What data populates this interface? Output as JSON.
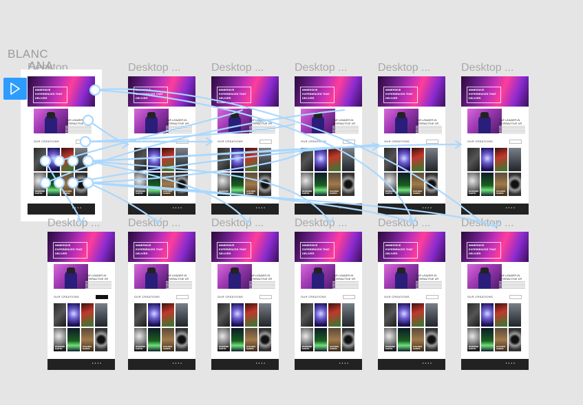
{
  "start": {
    "label_line1": "BLANC",
    "label_line2": "ANA",
    "play_icon": "play-icon"
  },
  "frames": [
    {
      "label": "Desktop ...",
      "hero": "IMMERSIVE EXPERIENCES THAT DELIVER",
      "leader": "THE LEADER IN INTERACTIVE VR",
      "creations": "OUR CREATIONS"
    },
    {
      "label": "Desktop ...",
      "hero": "IMMERSIVE EXPERIENCES THAT DELIVER",
      "leader": "THE LEADER IN INTERACTIVE VR",
      "creations": "OUR CREATIONS"
    },
    {
      "label": "Desktop ...",
      "hero": "IMMERSIVE EXPERIENCES THAT DELIVER",
      "leader": "THE LEADER IN INTERACTIVE VR",
      "creations": "OUR CREATIONS"
    },
    {
      "label": "Desktop ...",
      "hero": "IMMERSIVE EXPERIENCES THAT DELIVER",
      "leader": "THE LEADER IN INTERACTIVE VR",
      "creations": "OUR CREATIONS"
    },
    {
      "label": "Desktop ...",
      "hero": "IMMERSIVE EXPERIENCES THAT DELIVER",
      "leader": "THE LEADER IN INTERACTIVE VR",
      "creations": "OUR CREATIONS"
    },
    {
      "label": "Desktop ...",
      "hero": "IMMERSIVE EXPERIENCES THAT DELIVER",
      "leader": "THE LEADER IN INTERACTIVE VR",
      "creations": "OUR CREATIONS"
    },
    {
      "label": "Desktop ...",
      "hero": "IMMERSIVE EXPERIENCES THAT DELIVER",
      "leader": "THE LEADER IN INTERACTIVE VR",
      "creations": "OUR CREATIONS"
    },
    {
      "label": "Desktop ...",
      "hero": "IMMERSIVE EXPERIENCES THAT DELIVER",
      "leader": "THE LEADER IN INTERACTIVE VR",
      "creations": "OUR CREATIONS"
    },
    {
      "label": "Desktop ...",
      "hero": "IMMERSIVE EXPERIENCES THAT DELIVER",
      "leader": "THE LEADER IN INTERACTIVE VR",
      "creations": "OUR CREATIONS"
    },
    {
      "label": "Desktop ...",
      "hero": "IMMERSIVE EXPERIENCES THAT DELIVER",
      "leader": "THE LEADER IN INTERACTIVE VR",
      "creations": "OUR CREATIONS"
    },
    {
      "label": "Desktop ...",
      "hero": "IMMERSIVE EXPERIENCES THAT DELIVER",
      "leader": "THE LEADER IN INTERACTIVE VR",
      "creations": "OUR CREATIONS"
    },
    {
      "label": "Desktop ...",
      "hero": "IMMERSIVE EXPERIENCES THAT DELIVER",
      "leader": "THE LEADER IN INTERACTIVE VR",
      "creations": "OUR CREATIONS"
    }
  ],
  "tile_captions": [
    "",
    "",
    "",
    "",
    "DIAMOND EARTH",
    "",
    "GOLDEN SANDS",
    ""
  ],
  "colors": {
    "canvas_bg": "#e5e5e5",
    "accent": "#2d9cff",
    "wire": "#a9d8ff",
    "footer": "#222222"
  }
}
